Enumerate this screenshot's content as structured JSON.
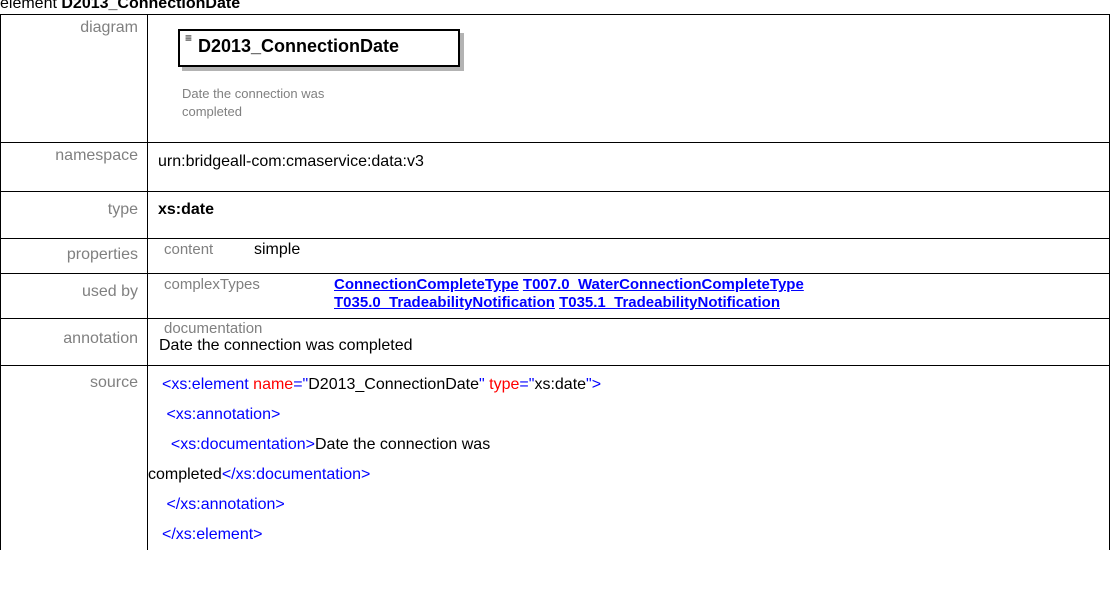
{
  "heading": {
    "prefix": "element",
    "name": "D2013_ConnectionDate"
  },
  "rows": {
    "diagram": {
      "label": "diagram",
      "box_icon": "≡",
      "box_name": "D2013_ConnectionDate",
      "note_line1": "Date the connection was",
      "note_line2": "completed"
    },
    "namespace": {
      "label": "namespace",
      "value": "urn:bridgeall-com:cmaservice:data:v3"
    },
    "type": {
      "label": "type",
      "value": "xs:date"
    },
    "properties": {
      "label": "properties",
      "key": "content",
      "value": "simple"
    },
    "used_by": {
      "label": "used by",
      "key": "complexTypes",
      "links": [
        "ConnectionCompleteType",
        "T007.0_WaterConnectionCompleteType",
        "T035.0_TradeabilityNotification",
        "T035.1_TradeabilityNotification"
      ]
    },
    "annotation": {
      "label": "annotation",
      "key": "documentation",
      "value": "Date the connection was completed"
    },
    "source": {
      "label": "source",
      "l1_open": "<xs:element",
      "l1_attr1": "name",
      "l1_eq1": "=\"",
      "l1_val1": "D2013_ConnectionDate",
      "l1_q1": "\"",
      "l1_attr2": "type",
      "l1_eq2": "=\"",
      "l1_val2": "xs:date",
      "l1_close": "\">",
      "l2": "<xs:annotation>",
      "l3_open": "<xs:documentation>",
      "l3_text": "Date the connection was",
      "l4_text": "completed",
      "l4_close": "</xs:documentation>",
      "l5": "</xs:annotation>",
      "l6": "</xs:element>"
    }
  },
  "colors": {
    "label": "#808080",
    "link": "#0000ff",
    "xml_tag": "#0000ff",
    "xml_attr": "#ff0000"
  }
}
